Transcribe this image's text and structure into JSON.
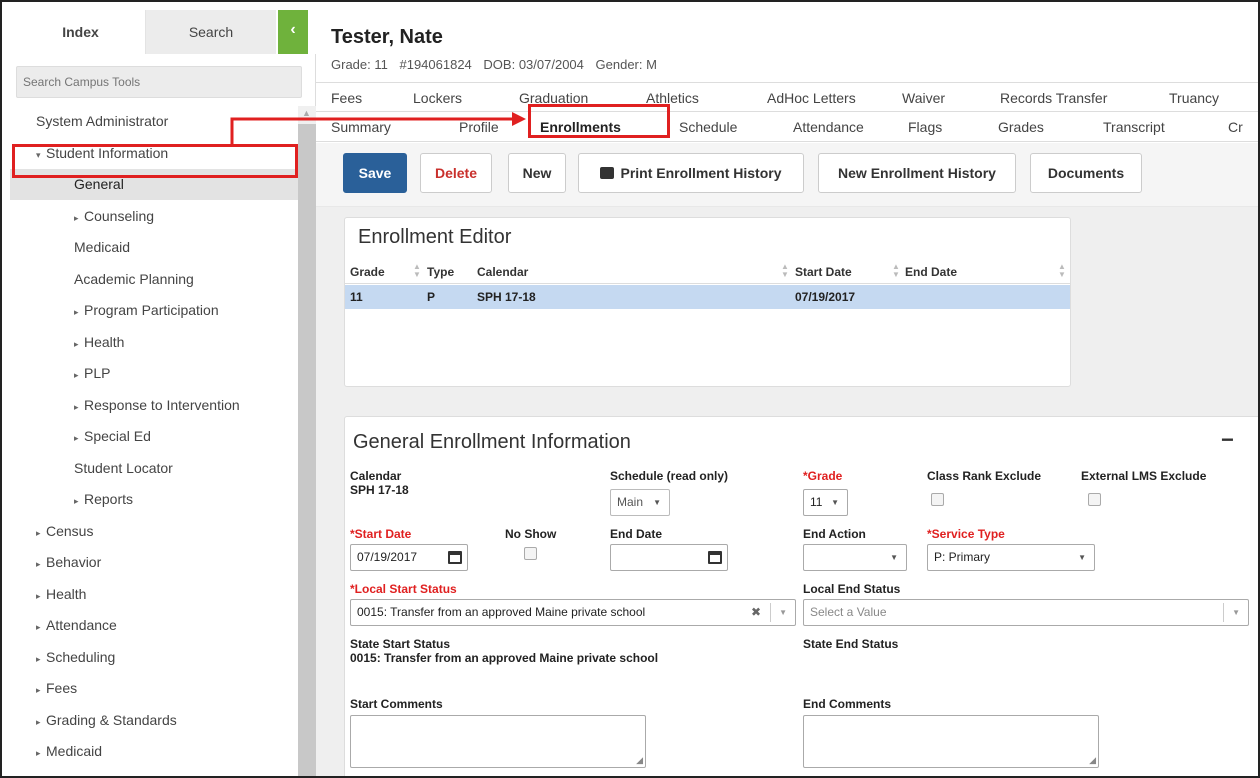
{
  "sidebar": {
    "tabs": {
      "index": "Index",
      "search": "Search"
    },
    "collapse_icon": "‹",
    "search_placeholder": "Search Campus Tools",
    "items": [
      {
        "label": "System Administrator",
        "level": 0,
        "arrow": ""
      },
      {
        "label": "Student Information",
        "level": 1,
        "arrow": "▾"
      },
      {
        "label": "General",
        "level": 2,
        "arrow": "",
        "selected": true
      },
      {
        "label": "Counseling",
        "level": 2,
        "arrow": "▸"
      },
      {
        "label": "Medicaid",
        "level": 2,
        "arrow": ""
      },
      {
        "label": "Academic Planning",
        "level": 2,
        "arrow": ""
      },
      {
        "label": "Program Participation",
        "level": 2,
        "arrow": "▸"
      },
      {
        "label": "Health",
        "level": 2,
        "arrow": "▸"
      },
      {
        "label": "PLP",
        "level": 2,
        "arrow": "▸"
      },
      {
        "label": "Response to Intervention",
        "level": 2,
        "arrow": "▸"
      },
      {
        "label": "Special Ed",
        "level": 2,
        "arrow": "▸"
      },
      {
        "label": "Student Locator",
        "level": 2,
        "arrow": ""
      },
      {
        "label": "Reports",
        "level": 2,
        "arrow": "▸"
      },
      {
        "label": "Census",
        "level": 1,
        "arrow": "▸"
      },
      {
        "label": "Behavior",
        "level": 1,
        "arrow": "▸"
      },
      {
        "label": "Health",
        "level": 1,
        "arrow": "▸"
      },
      {
        "label": "Attendance",
        "level": 1,
        "arrow": "▸"
      },
      {
        "label": "Scheduling",
        "level": 1,
        "arrow": "▸"
      },
      {
        "label": "Fees",
        "level": 1,
        "arrow": "▸"
      },
      {
        "label": "Grading & Standards",
        "level": 1,
        "arrow": "▸"
      },
      {
        "label": "Medicaid",
        "level": 1,
        "arrow": "▸"
      }
    ]
  },
  "student": {
    "name": "Tester, Nate",
    "grade": "Grade: 11",
    "id": "#194061824",
    "dob": "DOB: 03/07/2004",
    "gender": "Gender: M"
  },
  "tabs_row1": [
    "Fees",
    "Lockers",
    "Graduation",
    "Athletics",
    "AdHoc Letters",
    "Waiver",
    "Records Transfer",
    "Truancy"
  ],
  "tabs_row2": [
    "Summary",
    "Profile",
    "Enrollments",
    "Schedule",
    "Attendance",
    "Flags",
    "Grades",
    "Transcript",
    "Cr"
  ],
  "active_tab": "Enrollments",
  "toolbar": {
    "save": "Save",
    "delete": "Delete",
    "new": "New",
    "print_history": "Print Enrollment History",
    "new_history": "New Enrollment History",
    "documents": "Documents"
  },
  "editor": {
    "title": "Enrollment Editor",
    "columns": [
      "Grade",
      "Type",
      "Calendar",
      "Start Date",
      "End Date"
    ],
    "rows": [
      {
        "grade": "11",
        "type": "P",
        "calendar": "SPH 17-18",
        "start_date": "07/19/2017",
        "end_date": ""
      }
    ]
  },
  "general": {
    "title": "General Enrollment Information",
    "collapse_icon": "−",
    "calendar_label": "Calendar",
    "calendar_value": "SPH 17-18",
    "schedule_label": "Schedule (read only)",
    "schedule_value": "Main",
    "grade_label": "*Grade",
    "grade_value": "11",
    "class_rank_label": "Class Rank Exclude",
    "external_lms_label": "External LMS Exclude",
    "start_date_label": "*Start Date",
    "start_date_value": "07/19/2017",
    "no_show_label": "No Show",
    "end_date_label": "End Date",
    "end_date_value": "",
    "end_action_label": "End Action",
    "end_action_value": "",
    "service_type_label": "*Service Type",
    "service_type_value": "P: Primary",
    "local_start_label": "*Local Start Status",
    "local_start_value": "0015: Transfer from an approved Maine private school",
    "local_end_label": "Local End Status",
    "local_end_placeholder": "Select a Value",
    "state_start_label": "State Start Status",
    "state_start_value": "0015: Transfer from an approved Maine private school",
    "state_end_label": "State End Status",
    "start_comments_label": "Start Comments",
    "end_comments_label": "End Comments"
  },
  "colors": {
    "accent_red": "#e02020",
    "save_blue": "#2a6099",
    "green": "#6fb23c",
    "row_selected": "#c5d9f1"
  }
}
